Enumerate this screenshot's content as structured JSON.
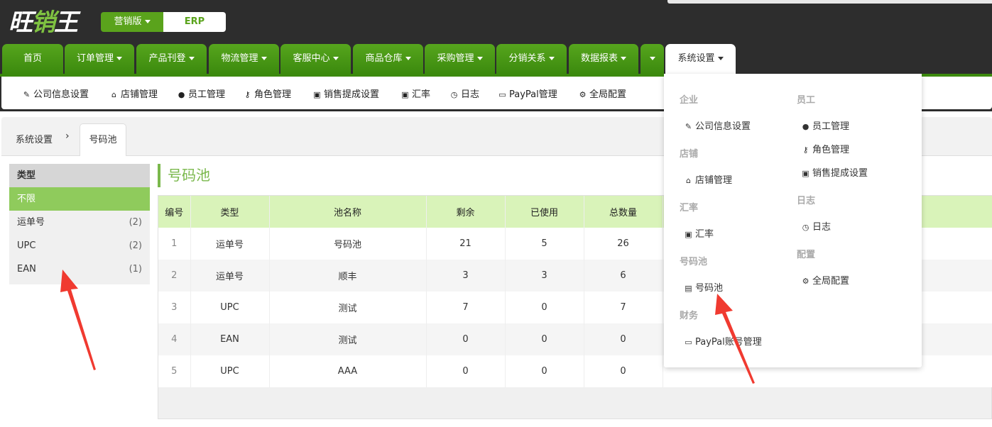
{
  "brand": {
    "logo_main": "旺",
    "logo_accent": "销",
    "logo_tail": "王",
    "edition": "营销版",
    "product": "ERP"
  },
  "nav": {
    "items": [
      {
        "label": "首页",
        "dropdown": false
      },
      {
        "label": "订单管理",
        "dropdown": true
      },
      {
        "label": "产品刊登",
        "dropdown": true
      },
      {
        "label": "物流管理",
        "dropdown": true
      },
      {
        "label": "客服中心",
        "dropdown": true
      },
      {
        "label": "商品仓库",
        "dropdown": true
      },
      {
        "label": "采购管理",
        "dropdown": true
      },
      {
        "label": "分销关系",
        "dropdown": true
      },
      {
        "label": "数据报表",
        "dropdown": true
      },
      {
        "label": "",
        "dropdown": true
      },
      {
        "label": "系统设置",
        "dropdown": true,
        "active": true
      }
    ]
  },
  "subnav": {
    "items": [
      {
        "label": "公司信息设置",
        "icon": "edit-icon"
      },
      {
        "label": "店铺管理",
        "icon": "home-icon"
      },
      {
        "label": "员工管理",
        "icon": "user-icon"
      },
      {
        "label": "角色管理",
        "icon": "key-icon"
      },
      {
        "label": "销售提成设置",
        "icon": "money-icon"
      },
      {
        "label": "汇率",
        "icon": "money-icon"
      },
      {
        "label": "日志",
        "icon": "clock-icon"
      },
      {
        "label": "PayPal管理",
        "icon": "credit-card-icon"
      },
      {
        "label": "全局配置",
        "icon": "gear-icon"
      }
    ]
  },
  "breadcrumb": {
    "parent": "系统设置",
    "current": "号码池"
  },
  "sidebar": {
    "header": "类型",
    "items": [
      {
        "label": "不限",
        "count": "",
        "selected": true
      },
      {
        "label": "运单号",
        "count": "(2)"
      },
      {
        "label": "UPC",
        "count": "(2)"
      },
      {
        "label": "EAN",
        "count": "(1)"
      }
    ]
  },
  "page_title": "号码池",
  "table": {
    "columns": [
      "编号",
      "类型",
      "池名称",
      "剩余",
      "已使用",
      "总数量"
    ],
    "rows": [
      [
        "1",
        "运单号",
        "号码池",
        "21",
        "5",
        "26"
      ],
      [
        "2",
        "运单号",
        "顺丰",
        "3",
        "3",
        "6"
      ],
      [
        "3",
        "UPC",
        "测试",
        "7",
        "0",
        "7"
      ],
      [
        "4",
        "EAN",
        "测试",
        "0",
        "0",
        "0"
      ],
      [
        "5",
        "UPC",
        "AAA",
        "0",
        "0",
        "0"
      ]
    ]
  },
  "dropdown": {
    "left": [
      {
        "header": "企业",
        "items": [
          {
            "label": "公司信息设置",
            "icon": "edit-icon"
          }
        ]
      },
      {
        "header": "店铺",
        "items": [
          {
            "label": "店铺管理",
            "icon": "home-icon"
          }
        ]
      },
      {
        "header": "汇率",
        "items": [
          {
            "label": "汇率",
            "icon": "money-icon"
          }
        ]
      },
      {
        "header": "号码池",
        "items": [
          {
            "label": "号码池",
            "icon": "inbox-icon"
          }
        ]
      },
      {
        "header": "财务",
        "items": [
          {
            "label": "PayPal账号管理",
            "icon": "credit-card-icon"
          }
        ]
      }
    ],
    "right": [
      {
        "header": "员工",
        "items": [
          {
            "label": "员工管理",
            "icon": "user-icon"
          },
          {
            "label": "角色管理",
            "icon": "key-icon"
          },
          {
            "label": "销售提成设置",
            "icon": "money-icon"
          }
        ]
      },
      {
        "header": "日志",
        "items": [
          {
            "label": "日志",
            "icon": "clock-icon"
          }
        ]
      },
      {
        "header": "配置",
        "items": [
          {
            "label": "全局配置",
            "icon": "gear-icon"
          }
        ]
      }
    ]
  },
  "colors": {
    "brand_green": "#5aa31c",
    "header_green": "#d9f3b9",
    "annotation_red": "#f03a30"
  }
}
